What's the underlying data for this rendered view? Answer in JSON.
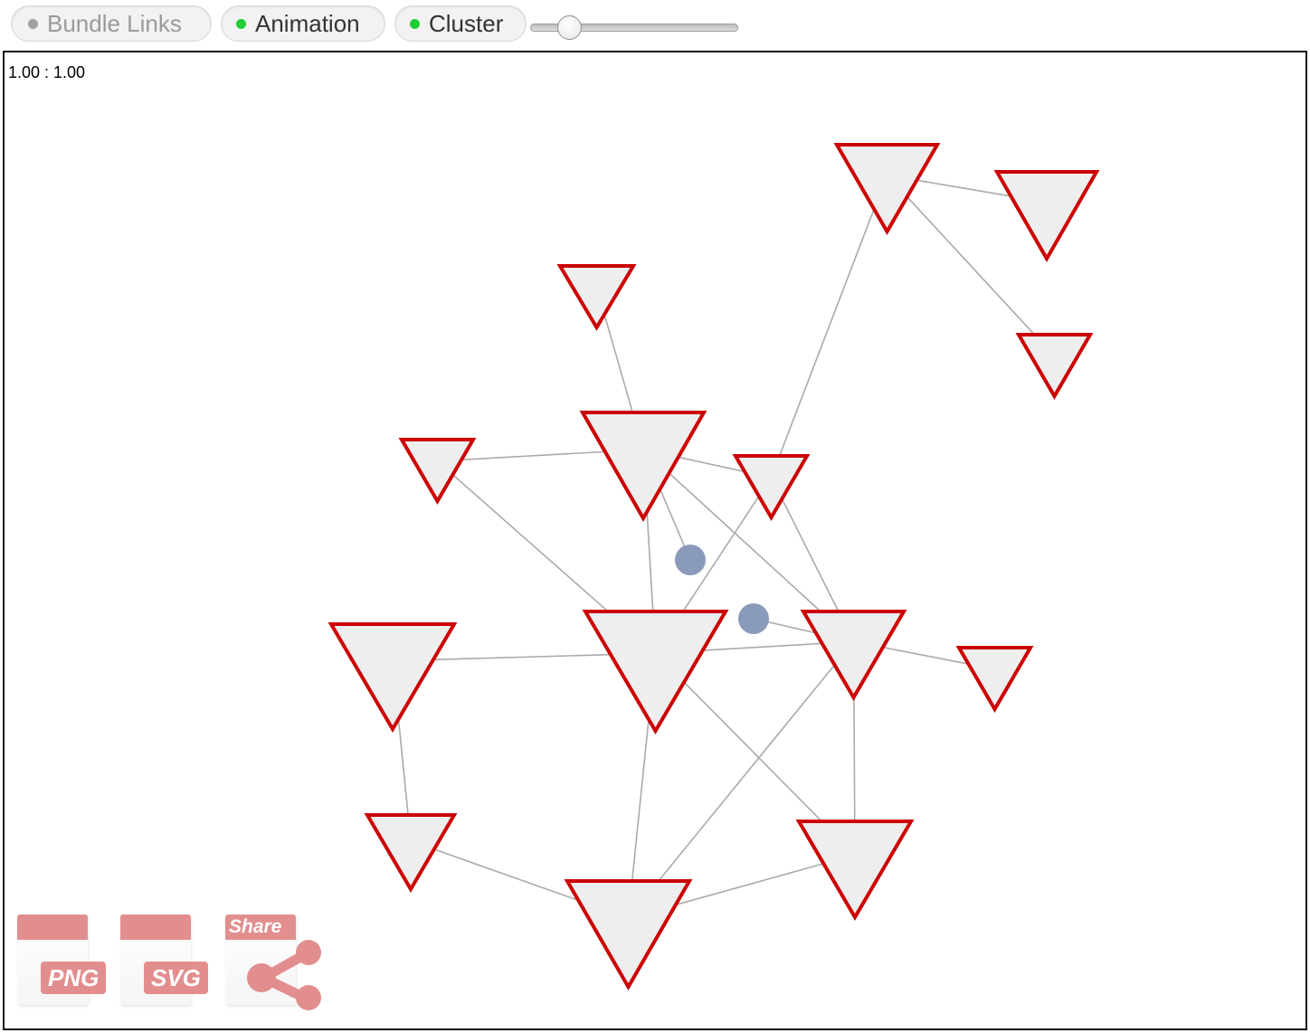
{
  "toolbar": {
    "bundle_label": "Bundle Links",
    "animation_label": "Animation",
    "cluster_label": "Cluster",
    "slider_value": 0.15
  },
  "canvas": {
    "zoom_text": "1.00 : 1.00"
  },
  "colors": {
    "node_fill": "#eeeeee",
    "node_stroke": "#cc0000",
    "cluster_node": "#8a9abb",
    "link": "#aaaaaa",
    "status_on": "#22cc33",
    "status_off": "#a0a0a0"
  },
  "export": {
    "png_label": "PNG",
    "svg_label": "SVG",
    "share_label": "Share"
  }
}
